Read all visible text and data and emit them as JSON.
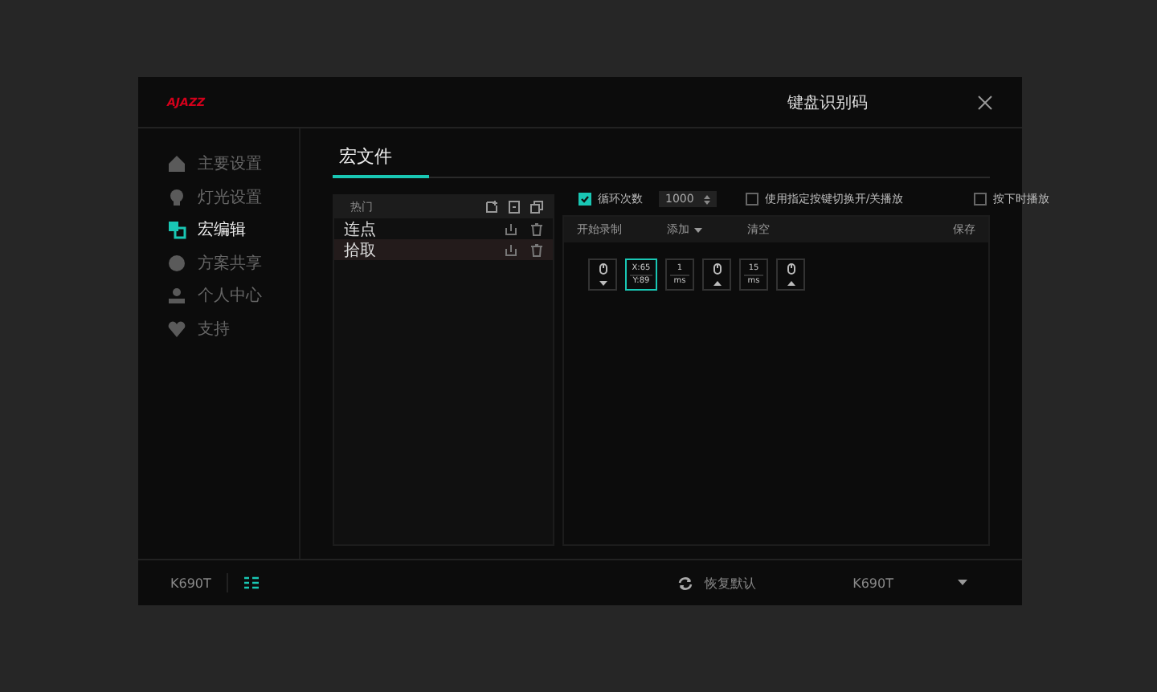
{
  "header": {
    "logo": "AJAZZ",
    "title": "键盘识别码"
  },
  "sidebar": {
    "items": [
      {
        "label": "主要设置",
        "selected": false
      },
      {
        "label": "灯光设置",
        "selected": false
      },
      {
        "label": "宏编辑",
        "selected": true
      },
      {
        "label": "方案共享",
        "selected": false
      },
      {
        "label": "个人中心",
        "selected": false
      },
      {
        "label": "支持",
        "selected": false
      }
    ]
  },
  "tab": {
    "label": "宏文件"
  },
  "macro_list": {
    "header": "热门",
    "items": [
      {
        "label": "连点",
        "selected": false
      },
      {
        "label": "拾取",
        "selected": true
      }
    ]
  },
  "options": {
    "loop": {
      "label": "循环次数",
      "checked": true,
      "value": "1000"
    },
    "toggle_key": {
      "label": "使用指定按键切换开/关播放",
      "checked": false
    },
    "hold": {
      "label": "按下时播放",
      "checked": false
    }
  },
  "toolbar": {
    "record": "开始录制",
    "add": "添加",
    "clear": "清空",
    "save": "保存"
  },
  "steps": [
    {
      "kind": "mouse_down",
      "selected": false
    },
    {
      "kind": "position",
      "x": "X:65",
      "y": "Y:89",
      "selected": true
    },
    {
      "kind": "delay",
      "value": "1",
      "unit": "ms",
      "selected": false
    },
    {
      "kind": "mouse_up",
      "selected": false
    },
    {
      "kind": "delay",
      "value": "15",
      "unit": "ms",
      "selected": false
    },
    {
      "kind": "mouse_up",
      "selected": false
    }
  ],
  "footer": {
    "device": "K690T",
    "reset": "恢复默认",
    "profile": "K690T"
  }
}
